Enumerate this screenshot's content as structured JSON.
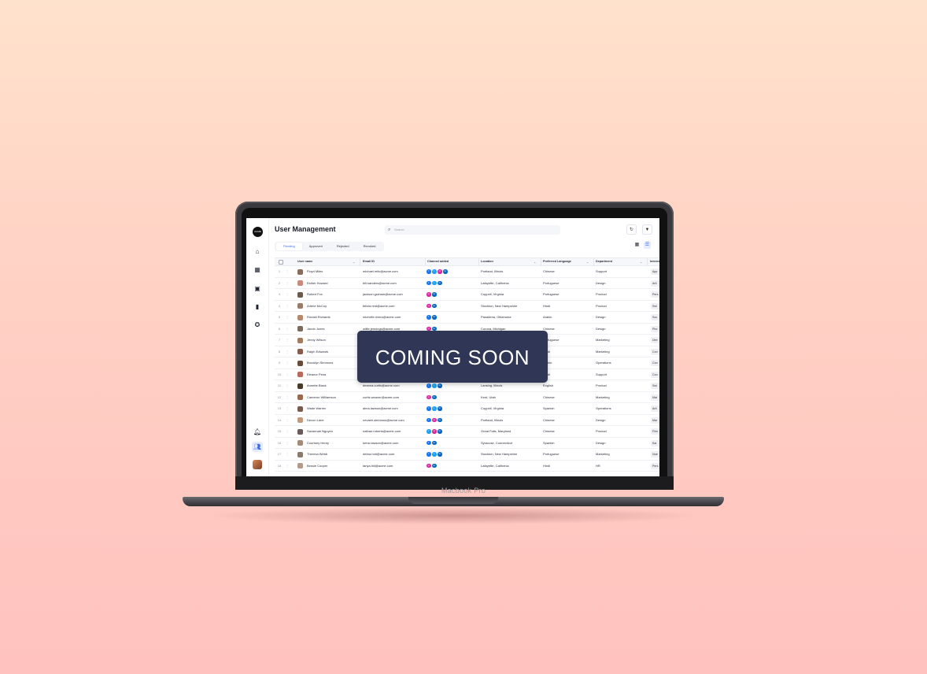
{
  "app": {
    "logo_text": "ACME",
    "title": "User Management",
    "search": {
      "placeholder": "Search"
    },
    "tabs": [
      {
        "label": "Pending",
        "active": true
      },
      {
        "label": "Approved",
        "active": false
      },
      {
        "label": "Rejected",
        "active": false
      },
      {
        "label": "Revoked",
        "active": false
      }
    ],
    "columns": {
      "user_name": "User name",
      "email": "Email ID",
      "channel": "Channel added",
      "location": "Location",
      "language": "Preferred Language",
      "department": "Department",
      "interests": "Interes"
    },
    "rows": [
      {
        "n": "1",
        "name": "Floyd Miles",
        "email": "michael.mitc@acme.com",
        "channels": [
          "facebook",
          "twitter",
          "instagram",
          "linkedin"
        ],
        "location": "Portland, Illinois",
        "language": "Chinese",
        "department": "Support",
        "interest": "App"
      },
      {
        "n": "2",
        "name": "Esther Howard",
        "email": "bill.sanders@acme.com",
        "channels": [
          "facebook",
          "twitter",
          "linkedin"
        ],
        "location": "Lafayette, California",
        "language": "Portuguese",
        "department": "Design",
        "interest": "Arti"
      },
      {
        "n": "3",
        "name": "Robert Fox",
        "email": "jackson.graham@acme.com",
        "channels": [
          "instagram",
          "linkedin"
        ],
        "location": "Coppell, Virginia",
        "language": "Portuguese",
        "department": "Product",
        "interest": "Pers"
      },
      {
        "n": "4",
        "name": "Arlene McCoy",
        "email": "felicia.reid@acme.com",
        "channels": [
          "instagram",
          "linkedin"
        ],
        "location": "Stockton, New Hampshire",
        "language": "Hindi",
        "department": "Product",
        "interest": "Swi"
      },
      {
        "n": "5",
        "name": "Ronald Richards",
        "email": "michelle.rivera@acme.com",
        "channels": [
          "facebook",
          "linkedin"
        ],
        "location": "Pasadena, Oklahoma",
        "language": "Arabic",
        "department": "Design",
        "interest": "Soc"
      },
      {
        "n": "6",
        "name": "Jacob Jones",
        "email": "willie.jennings@acme.com",
        "channels": [
          "instagram",
          "linkedin"
        ],
        "location": "Corona, Michigan",
        "language": "Chinese",
        "department": "Design",
        "interest": "Pho"
      },
      {
        "n": "7",
        "name": "Jenny Wilson",
        "email": "",
        "channels": [],
        "location": "",
        "language": "Portuguese",
        "department": "Marketing",
        "interest": "Dire"
      },
      {
        "n": "8",
        "name": "Ralph Edwards",
        "email": "",
        "channels": [],
        "location": "",
        "language": "Hindi",
        "department": "Marketing",
        "interest": "Con"
      },
      {
        "n": "9",
        "name": "Brooklyn Simmons",
        "email": "",
        "channels": [],
        "location": "",
        "language": "Arabic",
        "department": "Operations",
        "interest": "Con"
      },
      {
        "n": "10",
        "name": "Eleanor Pena",
        "email": "",
        "channels": [],
        "location": "",
        "language": "Hindi",
        "department": "Support",
        "interest": "Con"
      },
      {
        "n": "11",
        "name": "Annette Black",
        "email": "deanna.curtis@acme.com",
        "channels": [
          "facebook",
          "twitter",
          "linkedin"
        ],
        "location": "Lansing, Illinois",
        "language": "English",
        "department": "Product",
        "interest": "Swi"
      },
      {
        "n": "12",
        "name": "Cameron Williamson",
        "email": "curtis.weaver@acme.com",
        "channels": [
          "instagram",
          "linkedin"
        ],
        "location": "Kent, Utah",
        "language": "Chinese",
        "department": "Marketing",
        "interest": "Mat"
      },
      {
        "n": "13",
        "name": "Wade Warren",
        "email": "alma.lawson@acme.com",
        "channels": [
          "facebook",
          "twitter",
          "linkedin"
        ],
        "location": "Coppell, Virginia",
        "language": "Spanish",
        "department": "Operations",
        "interest": "Arti"
      },
      {
        "n": "14",
        "name": "Devon Lane",
        "email": "nevaeh.simmons@acme.com",
        "channels": [
          "facebook",
          "instagram",
          "linkedin"
        ],
        "location": "Portland, Illinois",
        "language": "Chinese",
        "department": "Design",
        "interest": "Mar"
      },
      {
        "n": "15",
        "name": "Savannah Nguyen",
        "email": "nathan.roberts@acme.com",
        "channels": [
          "twitter",
          "instagram",
          "linkedin"
        ],
        "location": "Great Falls, Maryland",
        "language": "Chinese",
        "department": "Product",
        "interest": "Film"
      },
      {
        "n": "16",
        "name": "Courtney Henry",
        "email": "kenzi.lawson@acme.com",
        "channels": [
          "facebook",
          "linkedin"
        ],
        "location": "Syracuse, Connecticut",
        "language": "Spanish",
        "department": "Design",
        "interest": "Kar"
      },
      {
        "n": "17",
        "name": "Theresa Webb",
        "email": "debra.holt@acme.com",
        "channels": [
          "facebook",
          "twitter",
          "linkedin"
        ],
        "location": "Stockton, New Hampshire",
        "language": "Portuguese",
        "department": "Marketing",
        "interest": "Nutr"
      },
      {
        "n": "18",
        "name": "Bessie Cooper",
        "email": "tanya.hill@acme.com",
        "channels": [
          "instagram",
          "linkedin"
        ],
        "location": "Lafayette, California",
        "language": "Hindi",
        "department": "HR",
        "interest": "Pers"
      }
    ]
  },
  "overlay": {
    "text": "COMING SOON"
  },
  "device": {
    "label": "Macbook Pro"
  },
  "colors": {
    "accent": "#3b6be6",
    "overlay_bg": "#2f3656",
    "facebook": "#1877f2",
    "twitter": "#1da1f2",
    "instagram": "#d6249f",
    "linkedin": "#0a66c2"
  }
}
